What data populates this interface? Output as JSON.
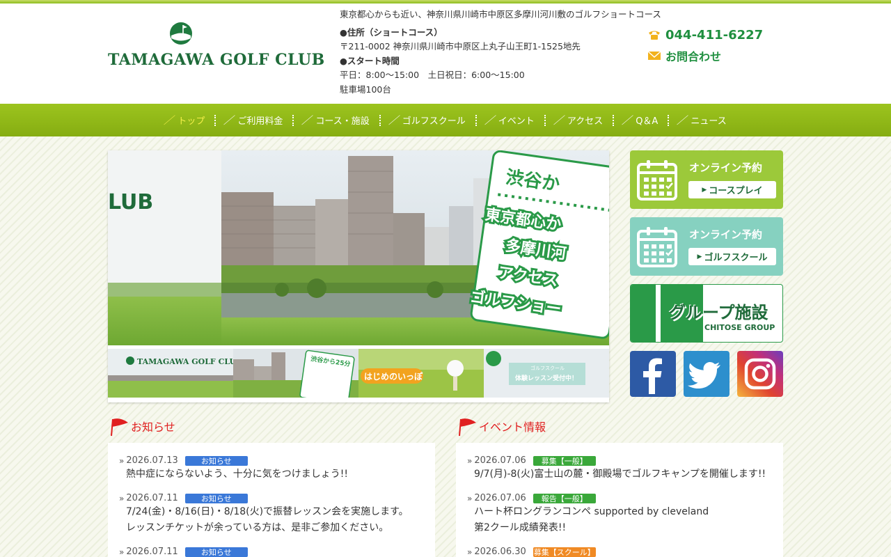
{
  "header": {
    "logo_text": "TAMAGAWA GOLF CLUB",
    "tagline": "東京都心からも近い、神奈川県川崎市中原区多摩川河川敷のゴルフショートコース",
    "address_heading": "●住所（ショートコース）",
    "address": "〒211-0002 神奈川県川崎市中原区上丸子山王町1-1525地先",
    "start_heading": "●スタート時間",
    "hours": "平日：8:00～15:00　土日祝日：6:00～15:00",
    "parking": "駐車場100台",
    "phone": "044-411-6227",
    "contact_label": "お問合わせ"
  },
  "nav": {
    "items": [
      {
        "label": "トップ",
        "active": true
      },
      {
        "label": "ご利用料金",
        "active": false
      },
      {
        "label": "コース・施設",
        "active": false
      },
      {
        "label": "ゴルフスクール",
        "active": false
      },
      {
        "label": "イベント",
        "active": false
      },
      {
        "label": "アクセス",
        "active": false
      },
      {
        "label": "Q＆A",
        "active": false
      },
      {
        "label": "ニュース",
        "active": false
      }
    ]
  },
  "slider": {
    "main_fragment_logo": "LUB",
    "main_card_lines": [
      "渋谷か",
      "東京都心か",
      "多摩川河",
      "アクセス",
      "ゴルフショー"
    ],
    "thumbs": [
      {
        "text": "TAMAGAWA GOLF CLUB"
      },
      {
        "text": "渋谷から25分"
      },
      {
        "text": "はじめのいっぽ"
      },
      {
        "text": "体験レッスン受付中！",
        "sub": "ゴルフスクール"
      }
    ]
  },
  "sidebar": {
    "banner1": {
      "title": "オンライン予約",
      "button": "コースプレイ"
    },
    "banner2": {
      "title": "オンライン予約",
      "button": "ゴルフスクール"
    },
    "banner3": {
      "title": "グループ施設",
      "subtitle": "CHITOSE GROUP"
    }
  },
  "notices": {
    "title": "お知らせ",
    "entries": [
      {
        "date": "2026.07.13",
        "tag": "お知らせ",
        "text": [
          "熱中症にならないよう、十分に気をつけましょう!!"
        ]
      },
      {
        "date": "2026.07.11",
        "tag": "お知らせ",
        "text": [
          "7/24(金)・8/16(日)・8/18(火)で振替レッスン会を実施します。",
          "レッスンチケットが余っている方は、是非ご参加ください。"
        ]
      },
      {
        "date": "2026.07.11",
        "tag": "お知らせ",
        "text": [
          ""
        ]
      }
    ]
  },
  "events": {
    "title": "イベント情報",
    "entries": [
      {
        "date": "2026.07.06",
        "tag": "募集【一般】",
        "text": [
          "9/7(月)-8(火)富士山の麓・御殿場でゴルフキャンプを開催します!!"
        ]
      },
      {
        "date": "2026.07.06",
        "tag": "報告【一般】",
        "text": [
          "ハート杯ロングランコンペ supported by cleveland",
          "第2クール成績発表!!"
        ]
      },
      {
        "date": "2026.06.30",
        "tag": "募集【スクール】",
        "text": [
          ""
        ]
      }
    ]
  },
  "colors": {
    "brand_green": "#8cbc1c",
    "dark_green": "#1f6b3a",
    "accent_red": "#e02020",
    "nav_active": "#f6f04a"
  }
}
